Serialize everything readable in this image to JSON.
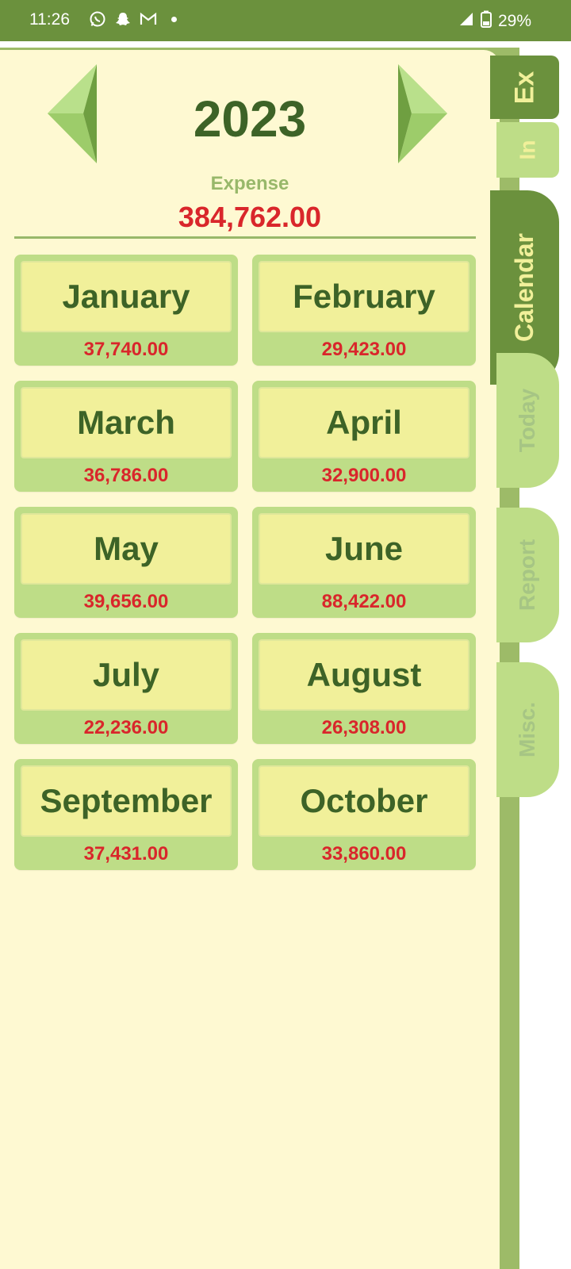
{
  "status_bar": {
    "time": "11:26",
    "battery": "29%",
    "icons": [
      "whatsapp-icon",
      "snapchat-icon",
      "gmail-icon",
      "notification-dot",
      "signal-icon",
      "battery-icon"
    ]
  },
  "header": {
    "year": "2023",
    "expense_label": "Expense",
    "expense_total": "384,762.00"
  },
  "months": [
    {
      "name": "January",
      "amount": "37,740.00"
    },
    {
      "name": "February",
      "amount": "29,423.00"
    },
    {
      "name": "March",
      "amount": "36,786.00"
    },
    {
      "name": "April",
      "amount": "32,900.00"
    },
    {
      "name": "May",
      "amount": "39,656.00"
    },
    {
      "name": "June",
      "amount": "88,422.00"
    },
    {
      "name": "July",
      "amount": "22,236.00"
    },
    {
      "name": "August",
      "amount": "26,308.00"
    },
    {
      "name": "September",
      "amount": "37,431.00"
    },
    {
      "name": "October",
      "amount": "33,860.00"
    }
  ],
  "tabs": {
    "ex": "Ex",
    "in": "In",
    "calendar": "Calendar",
    "today": "Today",
    "report": "Report",
    "misc": "Misc."
  },
  "colors": {
    "dark_green": "#6b913d",
    "light_green": "#bedd87",
    "cream": "#fef9d2",
    "yellow": "#f1f09a",
    "red": "#d9262b",
    "text_green": "#3d6327"
  }
}
